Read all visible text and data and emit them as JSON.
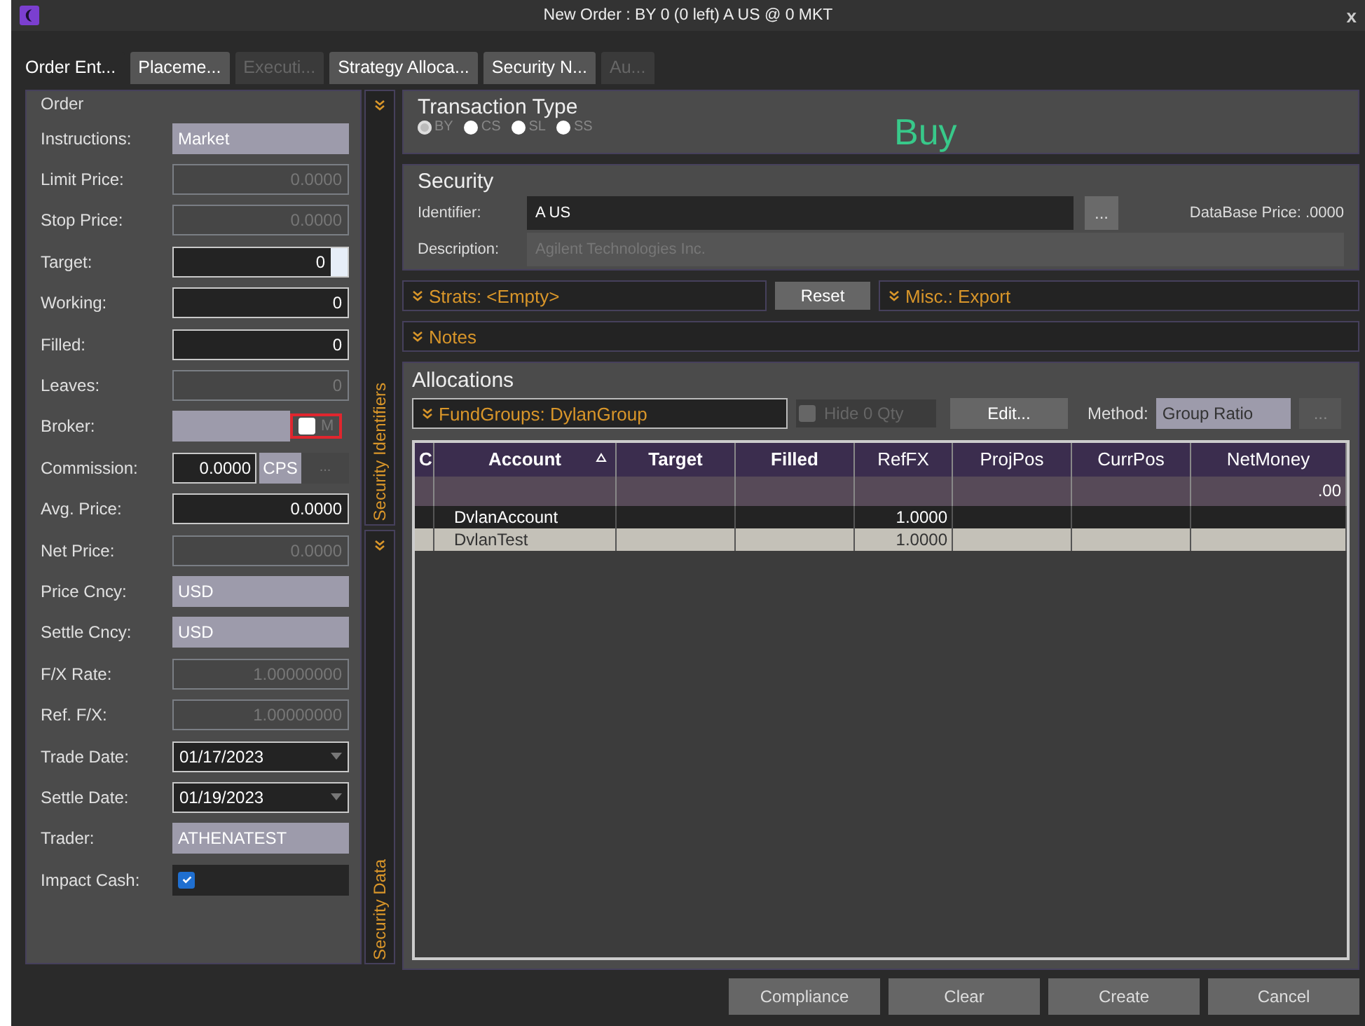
{
  "window": {
    "title": "New Order : BY 0 (0 left) A US @ 0 MKT",
    "close": "x"
  },
  "tabs": [
    {
      "label": "Order Ent...",
      "selected": true,
      "disabled": false
    },
    {
      "label": "Placeme...",
      "selected": false,
      "disabled": false
    },
    {
      "label": "Executi...",
      "selected": false,
      "disabled": true
    },
    {
      "label": "Strategy Alloca...",
      "selected": false,
      "disabled": false
    },
    {
      "label": "Security N...",
      "selected": false,
      "disabled": false
    },
    {
      "label": "Au...",
      "selected": false,
      "disabled": true
    }
  ],
  "order": {
    "title": "Order",
    "fields": [
      {
        "label": "Instructions:",
        "kind": "filled",
        "value": "Market"
      },
      {
        "label": "Limit Price:",
        "kind": "disabled",
        "value": "0.0000"
      },
      {
        "label": "Stop Price:",
        "kind": "disabled",
        "value": "0.0000"
      },
      {
        "label": "Target:",
        "kind": "spin",
        "value": "0"
      },
      {
        "label": "Working:",
        "kind": "input",
        "value": "0"
      },
      {
        "label": "Filled:",
        "kind": "input",
        "value": "0"
      },
      {
        "label": "Leaves:",
        "kind": "disabled",
        "value": "0"
      },
      {
        "label": "Broker:",
        "kind": "broker",
        "checked": false,
        "flag": "M",
        "highlighted": true
      },
      {
        "label": "Commission:",
        "kind": "commission",
        "value": "0.0000",
        "unit": "CPS",
        "more": "..."
      },
      {
        "label": "Avg. Price:",
        "kind": "input",
        "value": "0.0000"
      },
      {
        "label": "Net Price:",
        "kind": "disabled",
        "value": "0.0000"
      },
      {
        "label": "Price Cncy:",
        "kind": "filled",
        "value": "USD"
      },
      {
        "label": "Settle Cncy:",
        "kind": "filled",
        "value": "USD"
      },
      {
        "label": "F/X Rate:",
        "kind": "disabled",
        "value": "1.00000000"
      },
      {
        "label": "Ref. F/X:",
        "kind": "disabled",
        "value": "1.00000000"
      },
      {
        "label": "Trade Date:",
        "kind": "date",
        "value": "01/17/2023"
      },
      {
        "label": "Settle Date:",
        "kind": "date",
        "value": "01/19/2023"
      },
      {
        "label": "Trader:",
        "kind": "filled",
        "value": "ATHENATEST"
      },
      {
        "label": "Impact Cash:",
        "kind": "checkbox",
        "checked": true
      }
    ]
  },
  "side_strips": [
    {
      "label": "Security Identifiers"
    },
    {
      "label": "Security Data"
    }
  ],
  "transaction_type": {
    "title": "Transaction Type",
    "options": [
      {
        "label": "BY",
        "selected": true
      },
      {
        "label": "CS",
        "selected": false
      },
      {
        "label": "SL",
        "selected": false
      },
      {
        "label": "SS",
        "selected": false
      }
    ],
    "current": "Buy"
  },
  "security": {
    "title": "Security",
    "identifier_label": "Identifier:",
    "identifier": "A US",
    "lookup": "...",
    "price": "DataBase Price: .0000",
    "description_label": "Description:",
    "description": "Agilent Technologies Inc."
  },
  "strats": {
    "label": "Strats: <Empty>",
    "reset": "Reset",
    "misc": "Misc.: Export"
  },
  "notes": {
    "label": "Notes"
  },
  "allocations": {
    "title": "Allocations",
    "fund_groups": "FundGroups: DylanGroup",
    "hide_zero": {
      "label": "Hide 0 Qty",
      "checked": false
    },
    "edit": "Edit...",
    "method_label": "Method:",
    "method": "Group Ratio",
    "more": "...",
    "table": {
      "columns": [
        {
          "label": "C",
          "bold": true,
          "sorted": false
        },
        {
          "label": "Account",
          "bold": true,
          "sorted": true
        },
        {
          "label": "Target",
          "bold": true,
          "sorted": false
        },
        {
          "label": "Filled",
          "bold": true,
          "sorted": false
        },
        {
          "label": "RefFX",
          "bold": false,
          "sorted": false
        },
        {
          "label": "ProjPos",
          "bold": false,
          "sorted": false
        },
        {
          "label": "CurrPos",
          "bold": false,
          "sorted": false
        },
        {
          "label": "NetMoney",
          "bold": false,
          "sorted": false
        }
      ],
      "summary": {
        "net_money": ".00"
      },
      "rows": [
        {
          "cells": [
            "",
            "DvlanAccount",
            "",
            "",
            "1.0000",
            "",
            "",
            ""
          ],
          "selected": false
        },
        {
          "cells": [
            "",
            "DvlanTest",
            "",
            "",
            "1.0000",
            "",
            "",
            ""
          ],
          "selected": true
        }
      ]
    }
  },
  "buttons": [
    "Compliance",
    "Clear",
    "Create",
    "Cancel"
  ]
}
